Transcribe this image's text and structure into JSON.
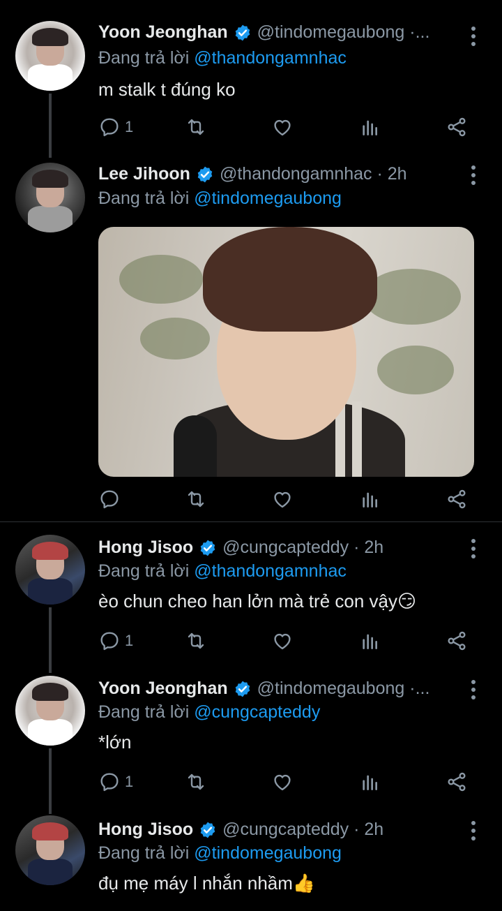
{
  "colors": {
    "background": "#000000",
    "text": "#e7e9ea",
    "muted": "#8b98a5",
    "accent": "#1d9bf0",
    "divider": "#2f3336"
  },
  "tweets": [
    {
      "name": "Yoon Jeonghan",
      "handle": "@tindomegaubong ·...",
      "reply_prefix": "Đang trả lời ",
      "reply_to": "@thandongamnhac",
      "text": "m stalk t đúng ko",
      "reply_count": "1",
      "avatar": "light-avatar"
    },
    {
      "name": "Lee Jihoon",
      "handle": "@thandongamnhac · 2h",
      "reply_prefix": "Đang trả lời ",
      "reply_to": "@tindomegaubong",
      "text": "",
      "reply_count": "",
      "avatar": "dark-avatar",
      "media": "photo"
    },
    {
      "name": "Hong Jisoo",
      "handle": "@cungcapteddy · 2h",
      "reply_prefix": "Đang trả lời ",
      "reply_to": "@thandongamnhac",
      "text": "èo chun cheo han lởn mà trẻ con vậy😏",
      "reply_count": "1",
      "avatar": "dark-avatar"
    },
    {
      "name": "Yoon Jeonghan",
      "handle": "@tindomegaubong ·...",
      "reply_prefix": "Đang trả lời ",
      "reply_to": "@cungcapteddy",
      "text": "*lớn",
      "reply_count": "1",
      "avatar": "light-avatar"
    },
    {
      "name": "Hong Jisoo",
      "handle": "@cungcapteddy · 2h",
      "reply_prefix": "Đang trả lời ",
      "reply_to": "@tindomegaubong",
      "text": "đụ mẹ máy l nhắn nhầm👍",
      "reply_count": "",
      "avatar": "dark-avatar"
    }
  ],
  "icons": {
    "reply": "reply-icon",
    "retweet": "retweet-icon",
    "like": "heart-icon",
    "stats": "stats-icon",
    "share": "share-icon",
    "more": "more-icon",
    "verified": "verified-badge-icon"
  }
}
